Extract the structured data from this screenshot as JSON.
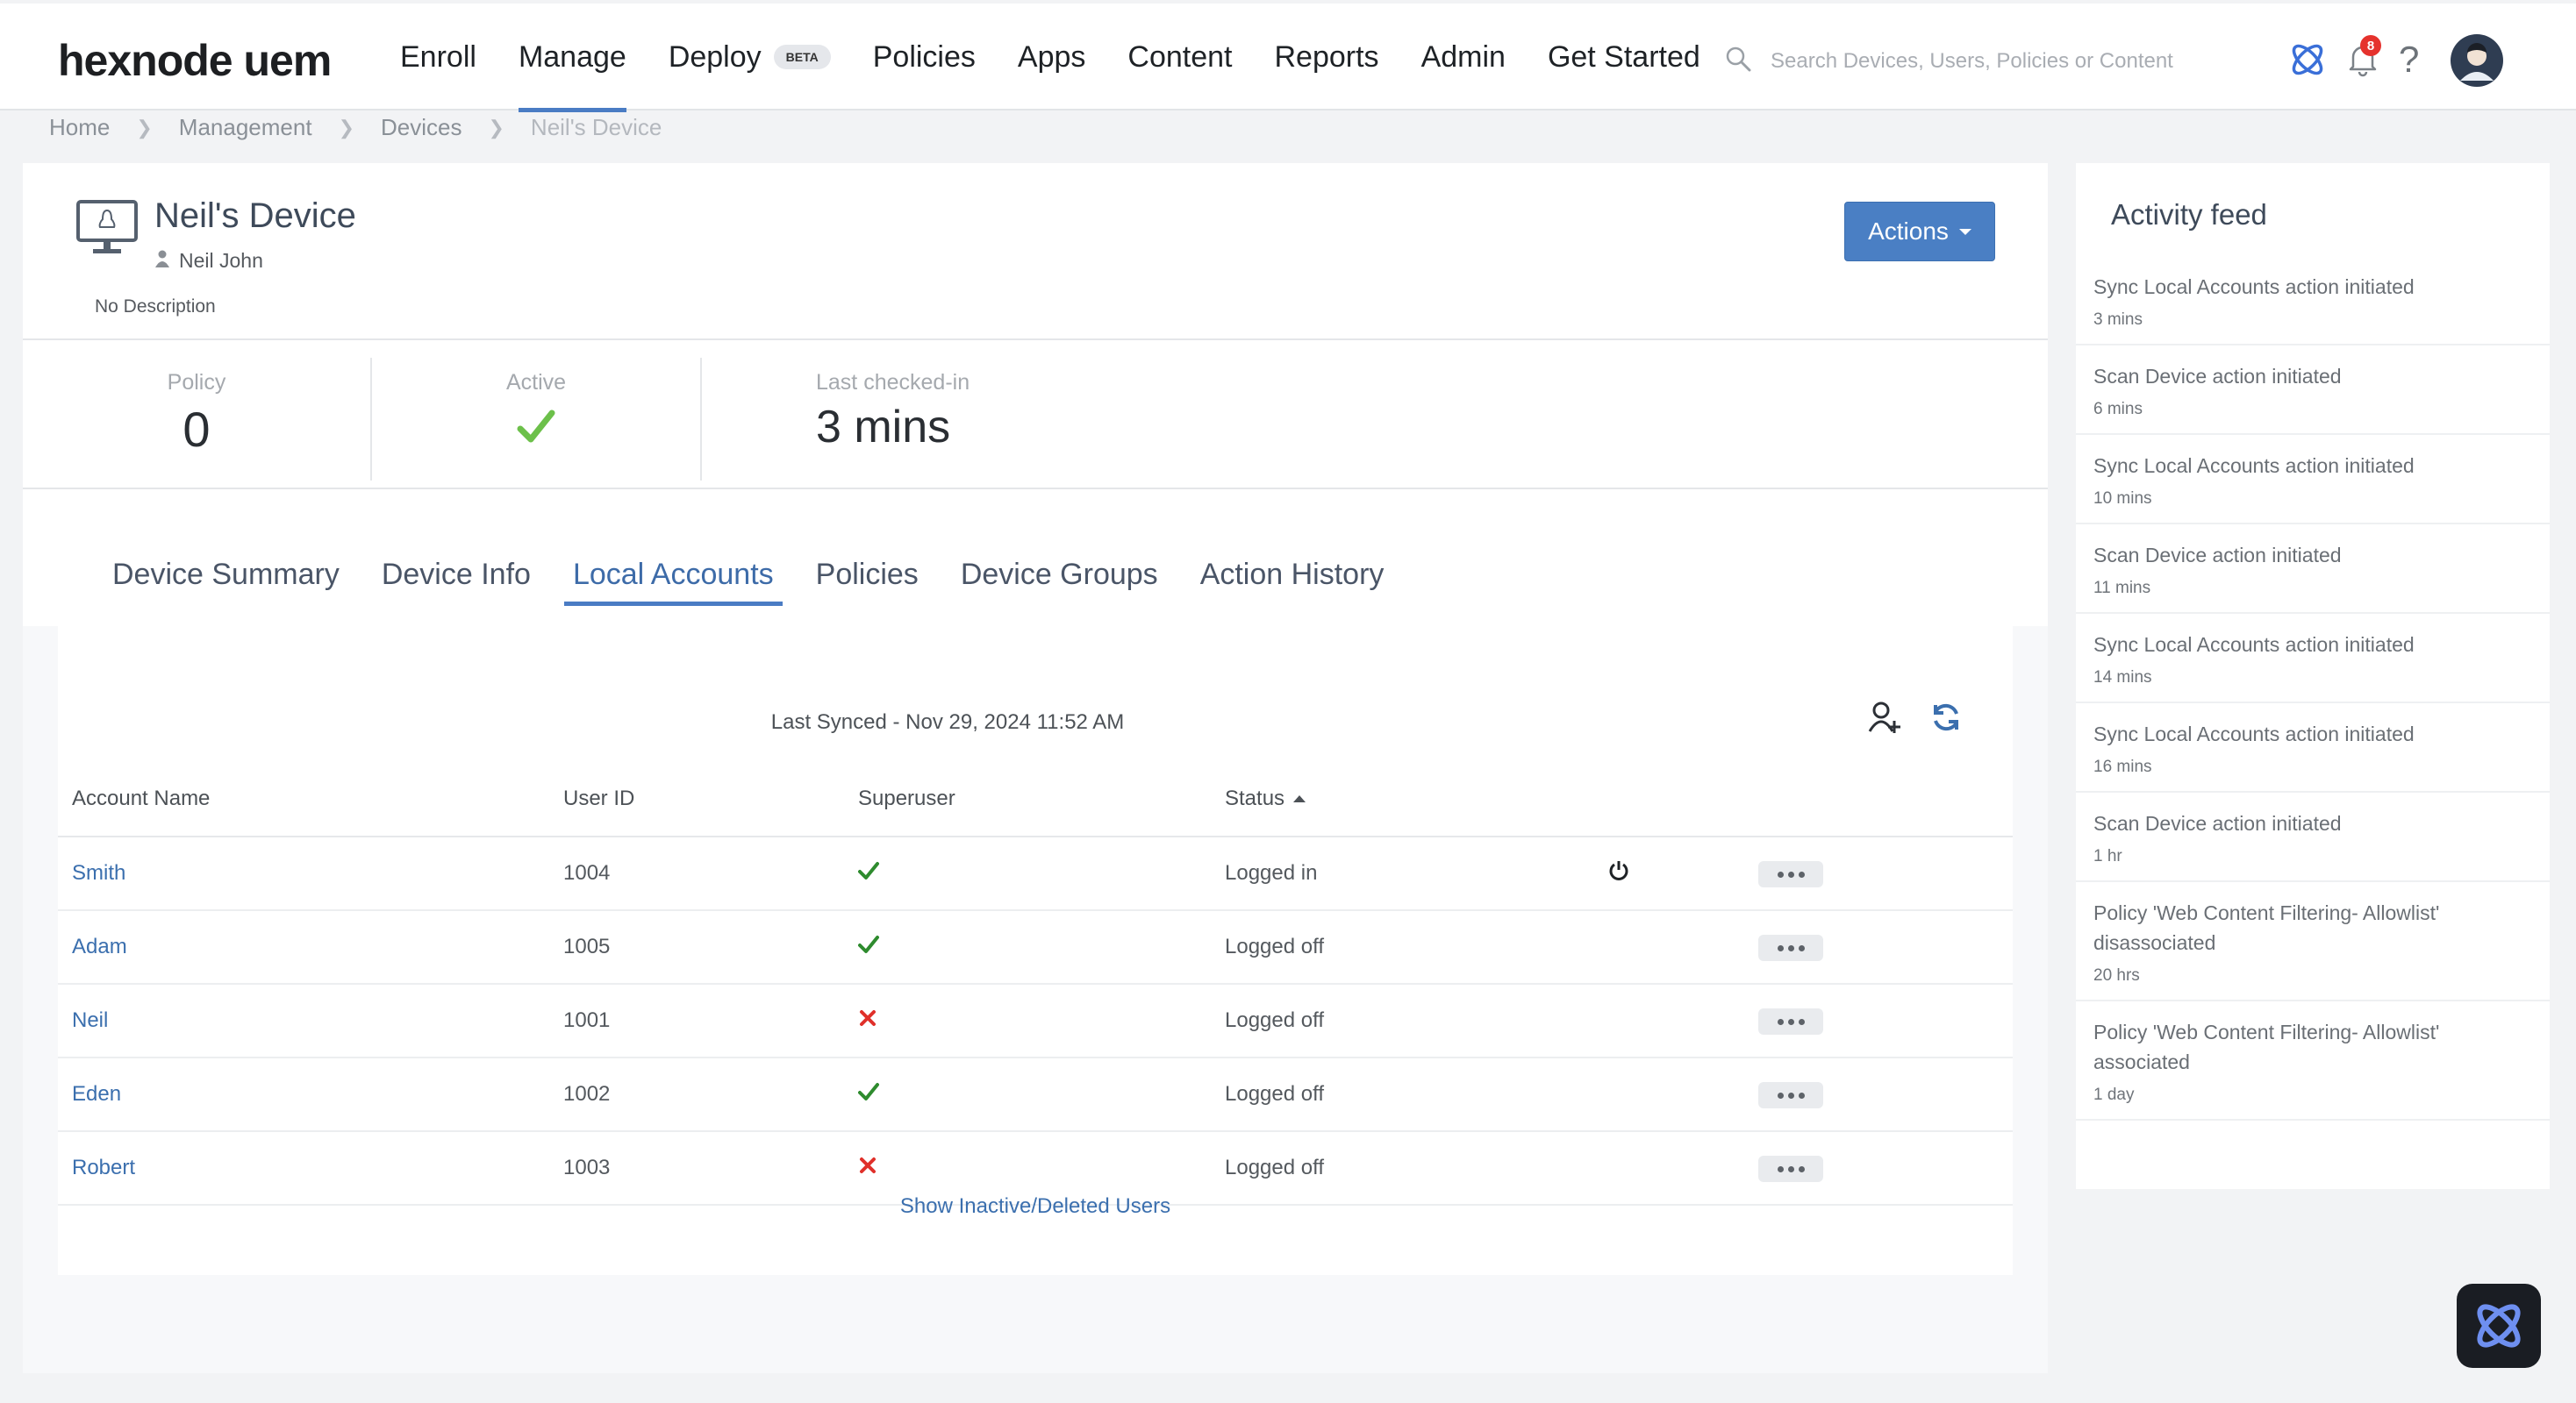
{
  "app": {
    "logo": "hexnode uem"
  },
  "nav": {
    "items": [
      {
        "label": "Enroll"
      },
      {
        "label": "Manage"
      },
      {
        "label": "Deploy"
      },
      {
        "label": "Policies"
      },
      {
        "label": "Apps"
      },
      {
        "label": "Content"
      },
      {
        "label": "Reports"
      },
      {
        "label": "Admin"
      },
      {
        "label": "Get Started"
      }
    ],
    "active": "Manage",
    "beta_badge": "BETA"
  },
  "search": {
    "placeholder": "Search Devices, Users, Policies or Content"
  },
  "notifications": {
    "count": "8"
  },
  "breadcrumb": [
    "Home",
    "Management",
    "Devices",
    "Neil's Device"
  ],
  "device": {
    "name": "Neil's Device",
    "owner": "Neil John",
    "description": "No Description",
    "actions_label": "Actions"
  },
  "stats": {
    "policy_label": "Policy",
    "policy_value": "0",
    "active_label": "Active",
    "checkin_label": "Last checked-in",
    "checkin_value": "3 mins"
  },
  "tabs": [
    {
      "label": "Device Summary"
    },
    {
      "label": "Device Info"
    },
    {
      "label": "Local Accounts"
    },
    {
      "label": "Policies"
    },
    {
      "label": "Device Groups"
    },
    {
      "label": "Action History"
    }
  ],
  "active_tab": "Local Accounts",
  "accounts": {
    "last_synced": "Last Synced - Nov 29, 2024 11:52 AM",
    "columns": [
      "Account Name",
      "User ID",
      "Superuser",
      "Status"
    ],
    "rows": [
      {
        "name": "Smith",
        "user_id": "1004",
        "superuser": true,
        "status": "Logged in"
      },
      {
        "name": "Adam",
        "user_id": "1005",
        "superuser": true,
        "status": "Logged off"
      },
      {
        "name": "Neil",
        "user_id": "1001",
        "superuser": false,
        "status": "Logged off"
      },
      {
        "name": "Eden",
        "user_id": "1002",
        "superuser": true,
        "status": "Logged off"
      },
      {
        "name": "Robert",
        "user_id": "1003",
        "superuser": false,
        "status": "Logged off"
      }
    ],
    "show_inactive": "Show Inactive/Deleted Users"
  },
  "feed": {
    "title": "Activity feed",
    "items": [
      {
        "text": "Sync Local Accounts action initiated",
        "time": "3 mins"
      },
      {
        "text": "Scan Device action initiated",
        "time": "6 mins"
      },
      {
        "text": "Sync Local Accounts action initiated",
        "time": "10 mins"
      },
      {
        "text": "Scan Device action initiated",
        "time": "11 mins"
      },
      {
        "text": "Sync Local Accounts action initiated",
        "time": "14 mins"
      },
      {
        "text": "Sync Local Accounts action initiated",
        "time": "16 mins"
      },
      {
        "text": "Scan Device action initiated",
        "time": "1 hr"
      },
      {
        "text": "Policy 'Web Content Filtering- Allowlist' disassociated",
        "time": "20 hrs"
      },
      {
        "text": "Policy 'Web Content Filtering- Allowlist' associated",
        "time": "1 day"
      }
    ]
  },
  "colors": {
    "accent": "#4a7cc4",
    "link": "#3b6fae",
    "check_green": "#2e8b2e",
    "cross_red": "#e0302a"
  }
}
